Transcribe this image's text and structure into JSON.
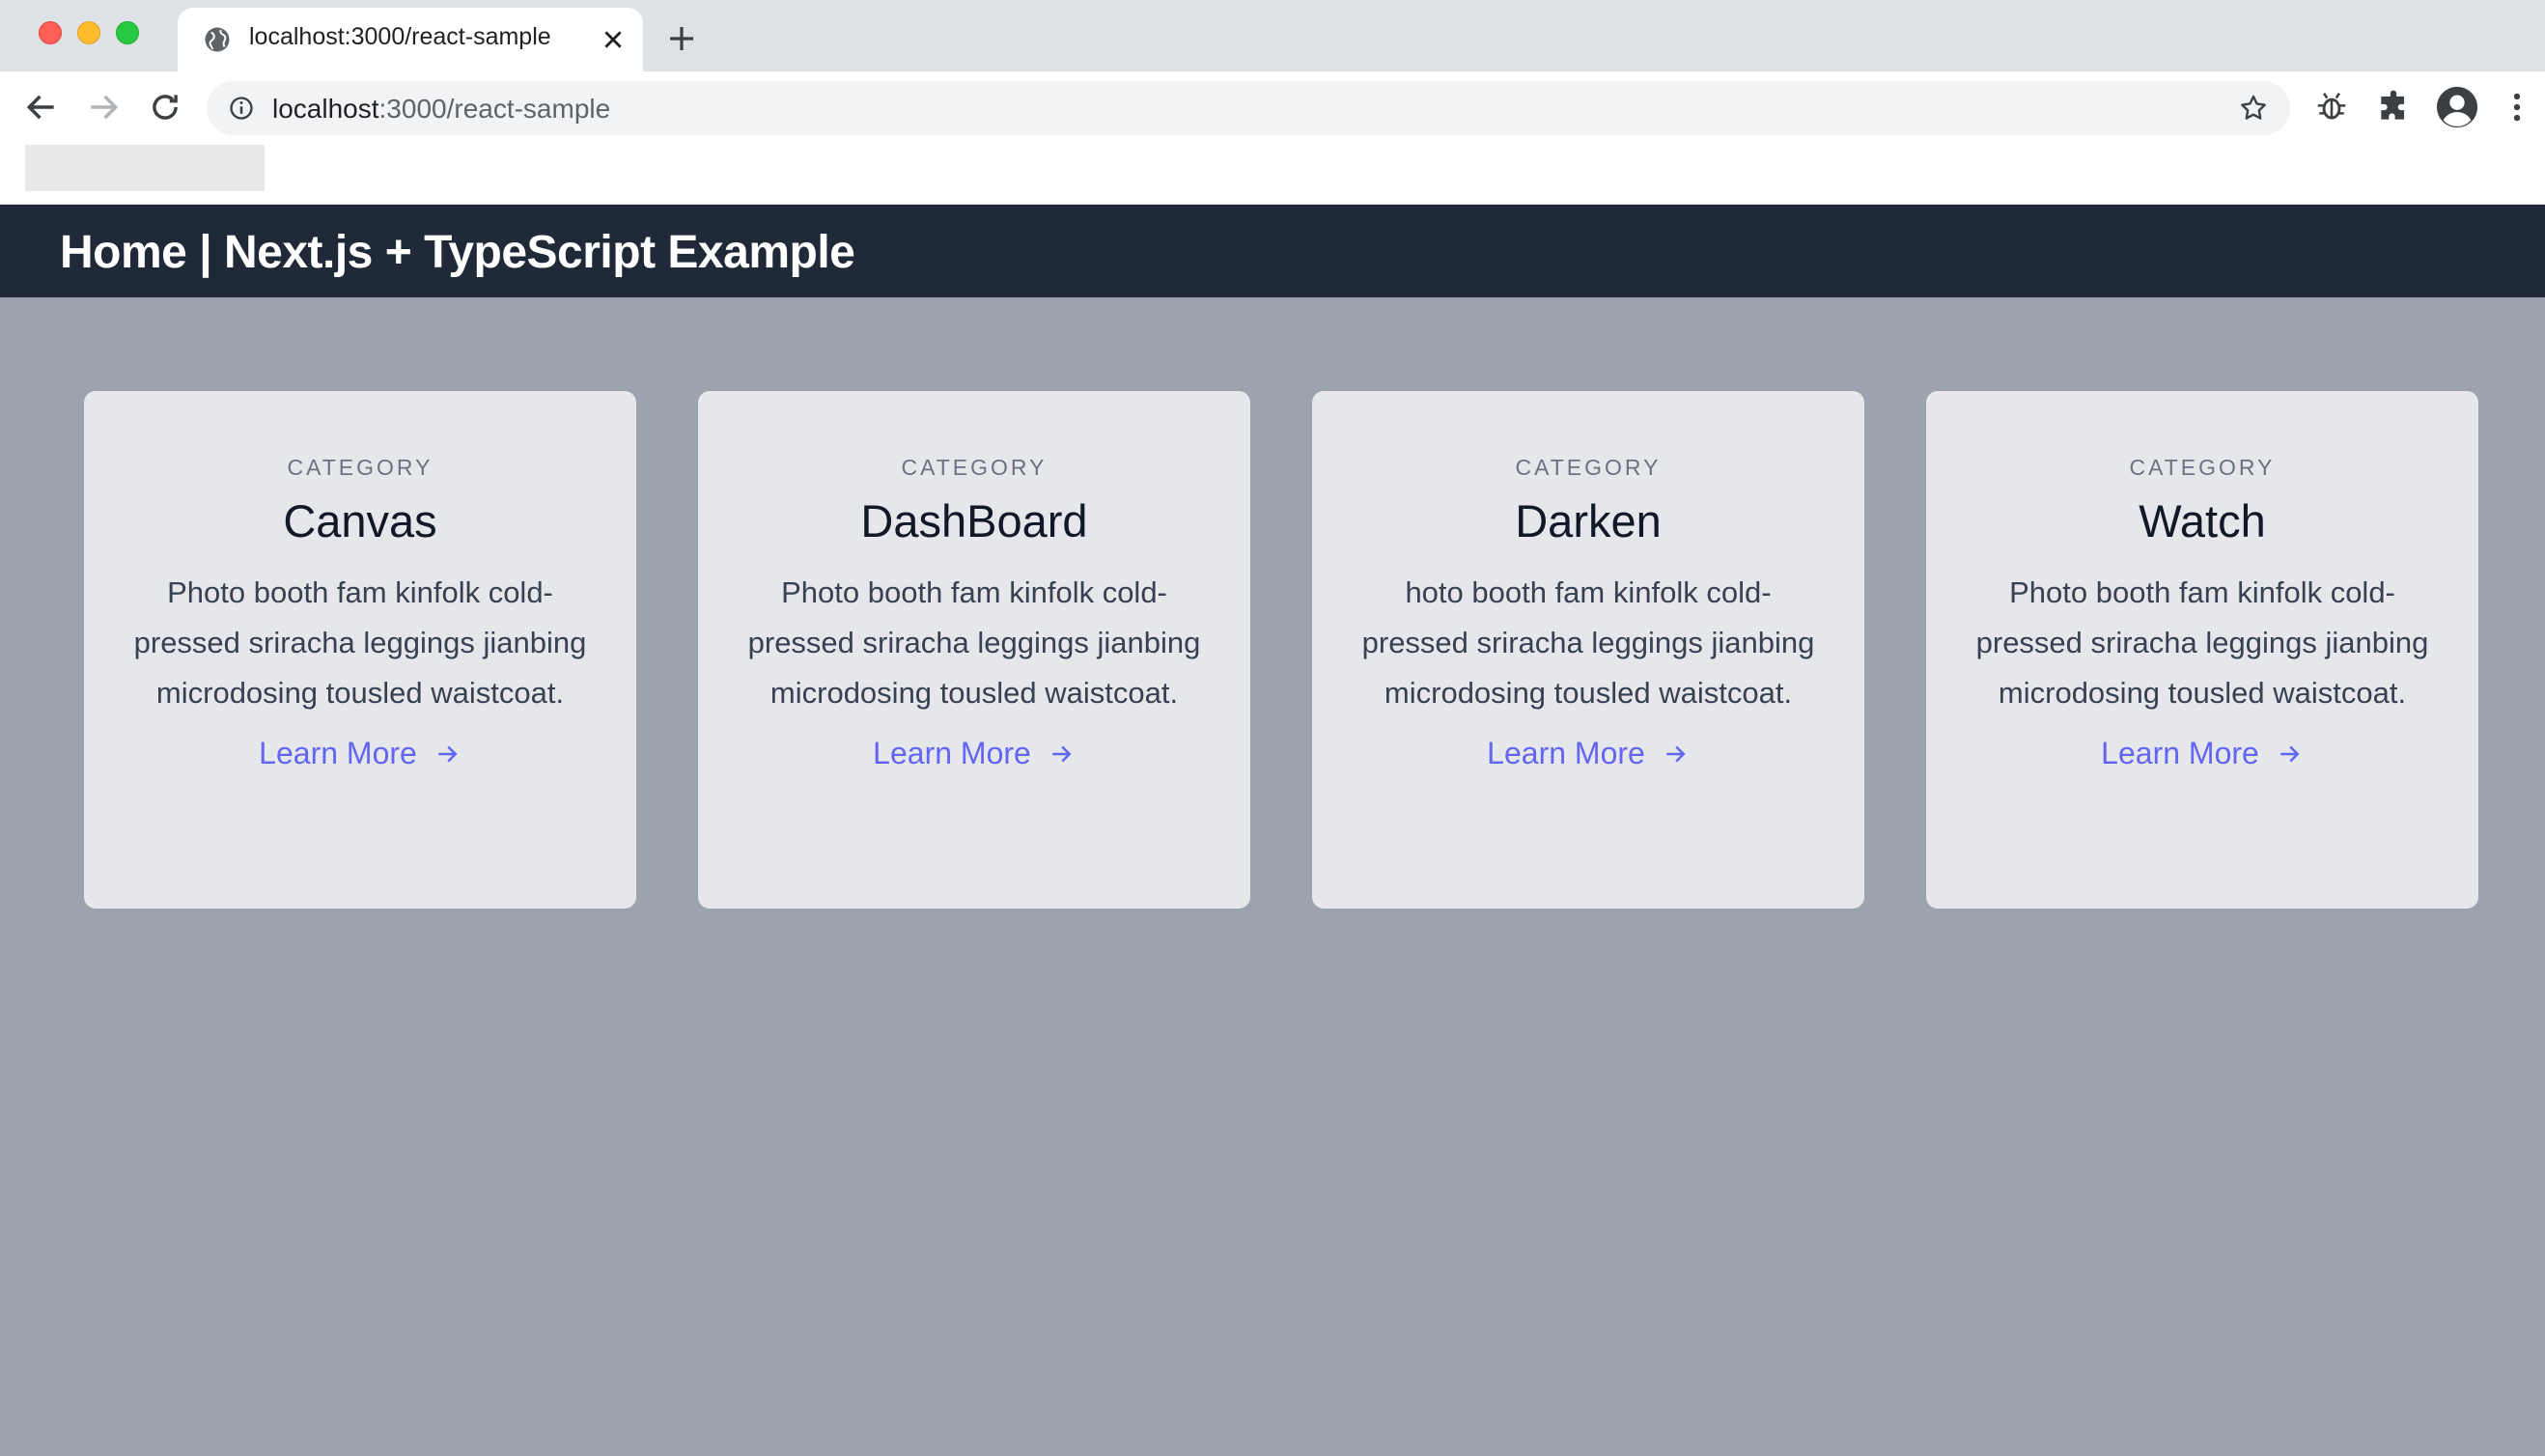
{
  "browser": {
    "tab_title": "localhost:3000/react-sample",
    "url_host": "localhost",
    "url_path": ":3000/react-sample"
  },
  "page": {
    "title": "Home | Next.js + TypeScript Example"
  },
  "cards": [
    {
      "category": "CATEGORY",
      "title": "Canvas",
      "text": "Photo booth fam kinfolk cold-pressed sriracha leggings jianbing microdosing tousled waistcoat.",
      "link": "Learn More"
    },
    {
      "category": "CATEGORY",
      "title": "DashBoard",
      "text": "Photo booth fam kinfolk cold-pressed sriracha leggings jianbing microdosing tousled waistcoat.",
      "link": "Learn More"
    },
    {
      "category": "CATEGORY",
      "title": "Darken",
      "text": "hoto booth fam kinfolk cold-pressed sriracha leggings jianbing microdosing tousled waistcoat.",
      "link": "Learn More"
    },
    {
      "category": "CATEGORY",
      "title": "Watch",
      "text": "Photo booth fam kinfolk cold-pressed sriracha leggings jianbing microdosing tousled waistcoat.",
      "link": "Learn More"
    }
  ],
  "colors": {
    "header_bg": "#1f2937",
    "page_bg": "#9ca3af",
    "card_bg": "#e5e7eb",
    "link": "#6366f1"
  }
}
